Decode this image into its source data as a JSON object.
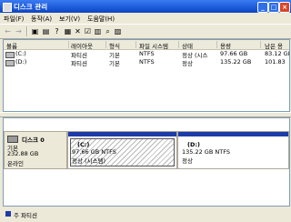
{
  "window": {
    "title": "디스크 관리"
  },
  "menu": [
    "파일(F)",
    "동작(A)",
    "보기(V)",
    "도움말(H)"
  ],
  "table": {
    "headers": [
      "볼륨",
      "레이아웃",
      "형식",
      "파일 시스템",
      "상태",
      "용량",
      "남은 용"
    ],
    "rows": [
      [
        "(C:)",
        "파티션",
        "기본",
        "NTFS",
        "정상 (시스",
        "97.66 GB",
        "83.12 GB"
      ],
      [
        "(D:)",
        "파티션",
        "기본",
        "NTFS",
        "정상",
        "135.22 GB",
        "101.83"
      ]
    ]
  },
  "disk": {
    "name": "디스크 0",
    "type": "기본",
    "size": "232.88 GB",
    "status": "온라인",
    "partitions": [
      {
        "label": "(C:)",
        "size": "97.66 GB NTFS",
        "status": "정상 (시스템)"
      },
      {
        "label": "(D:)",
        "size": "135.22 GB NTFS",
        "status": "정상"
      }
    ]
  },
  "legend": {
    "primary": "주 파티션"
  },
  "colors": {
    "partition_bar": "#1f3ba8",
    "title_bar": "#1c5ad8"
  }
}
